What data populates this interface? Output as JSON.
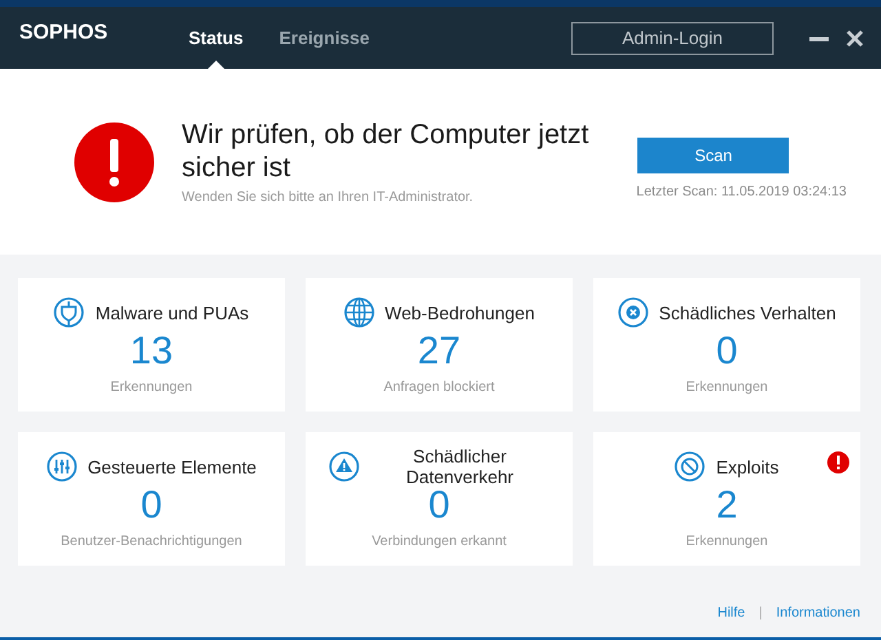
{
  "header": {
    "logo": "SOPHOS",
    "tabs": [
      {
        "label": "Status",
        "selected": true
      },
      {
        "label": "Ereignisse",
        "selected": false
      }
    ],
    "admin_button": "Admin-Login"
  },
  "banner": {
    "title": "Wir prüfen, ob der Computer jetzt sicher ist",
    "subtitle": "Wenden Sie sich bitte an Ihren IT-Administrator.",
    "scan_button": "Scan",
    "last_scan": "Letzter Scan: 11.05.2019 03:24:13"
  },
  "cards": [
    {
      "kind": "shield",
      "title": "Malware und PUAs",
      "count": "13",
      "caption": "Erkennungen",
      "alert": false
    },
    {
      "kind": "globe",
      "title": "Web-Bedrohungen",
      "count": "27",
      "caption": "Anfragen blockiert",
      "alert": false
    },
    {
      "kind": "x-circle",
      "title": "Schädliches Verhalten",
      "count": "0",
      "caption": "Erkennungen",
      "alert": false
    },
    {
      "kind": "sliders",
      "title": "Gesteuerte Elemente",
      "count": "0",
      "caption": "Benutzer-Benachrichtigungen",
      "alert": false
    },
    {
      "kind": "warning",
      "title": "Schädlicher Datenverkehr",
      "count": "0",
      "caption": "Verbindungen erkannt",
      "alert": false
    },
    {
      "kind": "block",
      "title": "Exploits",
      "count": "2",
      "caption": "Erkennungen",
      "alert": true
    }
  ],
  "footer": {
    "links": [
      "Hilfe",
      "Informationen"
    ],
    "separator": "|"
  }
}
